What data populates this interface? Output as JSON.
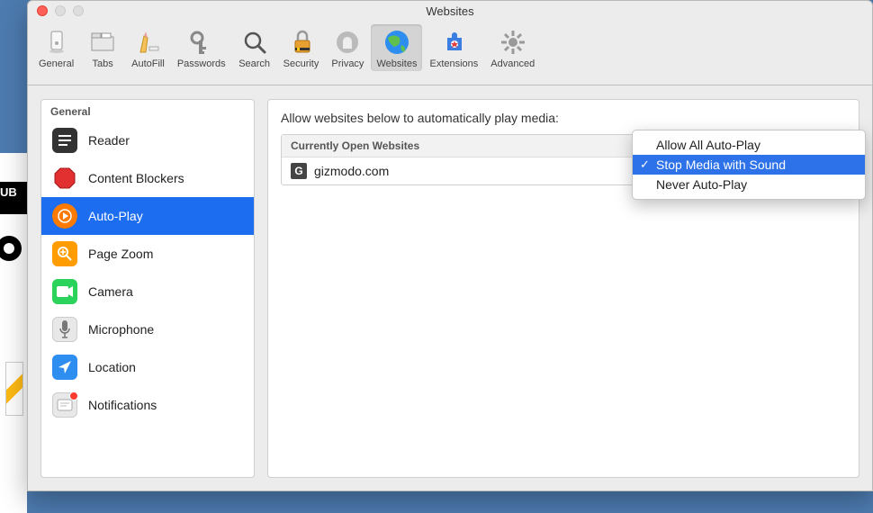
{
  "window": {
    "title": "Websites"
  },
  "toolbar": [
    {
      "id": "general",
      "label": "General",
      "icon": "general-icon"
    },
    {
      "id": "tabs",
      "label": "Tabs",
      "icon": "tabs-icon"
    },
    {
      "id": "autofill",
      "label": "AutoFill",
      "icon": "autofill-icon"
    },
    {
      "id": "passwords",
      "label": "Passwords",
      "icon": "passwords-icon"
    },
    {
      "id": "search",
      "label": "Search",
      "icon": "search-icon"
    },
    {
      "id": "security",
      "label": "Security",
      "icon": "security-icon"
    },
    {
      "id": "privacy",
      "label": "Privacy",
      "icon": "privacy-icon"
    },
    {
      "id": "websites",
      "label": "Websites",
      "icon": "websites-icon",
      "selected": true
    },
    {
      "id": "extensions",
      "label": "Extensions",
      "icon": "extensions-icon"
    },
    {
      "id": "advanced",
      "label": "Advanced",
      "icon": "advanced-icon"
    }
  ],
  "sidebar": {
    "section": "General",
    "items": [
      {
        "id": "reader",
        "label": "Reader",
        "icon": "reader-icon"
      },
      {
        "id": "blockers",
        "label": "Content Blockers",
        "icon": "stop-icon"
      },
      {
        "id": "autoplay",
        "label": "Auto-Play",
        "icon": "play-icon",
        "selected": true
      },
      {
        "id": "zoom",
        "label": "Page Zoom",
        "icon": "zoom-icon"
      },
      {
        "id": "camera",
        "label": "Camera",
        "icon": "camera-icon"
      },
      {
        "id": "microphone",
        "label": "Microphone",
        "icon": "microphone-icon"
      },
      {
        "id": "location",
        "label": "Location",
        "icon": "location-icon"
      },
      {
        "id": "notifications",
        "label": "Notifications",
        "icon": "notifications-icon",
        "badge": true
      }
    ]
  },
  "main": {
    "heading": "Allow websites below to automatically play media:",
    "list_header": "Currently Open Websites",
    "rows": [
      {
        "site": "gizmodo.com",
        "favicon": "G"
      }
    ]
  },
  "dropdown": {
    "items": [
      {
        "label": "Allow All Auto-Play"
      },
      {
        "label": "Stop Media with Sound",
        "selected": true
      },
      {
        "label": "Never Auto-Play"
      }
    ]
  },
  "bg": {
    "ub": "UB"
  }
}
